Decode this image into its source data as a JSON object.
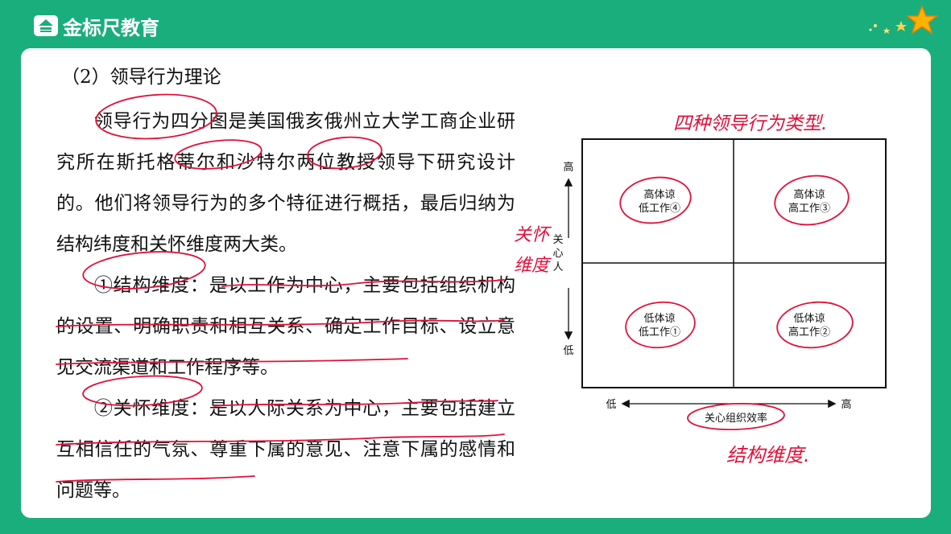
{
  "brand": {
    "name": "金标尺教育"
  },
  "colors": {
    "background": "#1aae7c",
    "card": "#ffffff",
    "annotation": "#e0103a",
    "text": "#111111"
  },
  "content": {
    "heading": "（2）领导行为理论",
    "para1": "领导行为四分图是美国俄亥俄州立大学工商企业研究所在斯托格蒂尔和沙特尔两位教授领导下研究设计的。他们将领导行为的多个特征进行概括，最后归纳为结构纬度和关怀维度两大类。",
    "para2": "①结构维度：是以工作为中心，主要包括组织机构的设置、明确职责和相互关系、确定工作目标、设立意见交流渠道和工作程序等。",
    "para3": "②关怀维度：是以人际关系为中心，主要包括建立互相信任的气氛、尊重下属的意见、注意下属的感情和问题等。"
  },
  "diagram": {
    "y_axis": {
      "label": "关心人",
      "high": "高",
      "low": "低"
    },
    "x_axis": {
      "label": "关心组织效率",
      "low": "低",
      "high": "高"
    },
    "quadrants": {
      "top_left": [
        "高体谅",
        "低工作④"
      ],
      "top_right": [
        "高体谅",
        "高工作③"
      ],
      "bottom_left": [
        "低体谅",
        "低工作①"
      ],
      "bottom_right": [
        "低体谅",
        "高工作②"
      ]
    }
  },
  "annotations": {
    "top_note": "四种领导行为类型.",
    "left_note": [
      "关怀",
      "维度"
    ],
    "bottom_note": "结构维度."
  }
}
